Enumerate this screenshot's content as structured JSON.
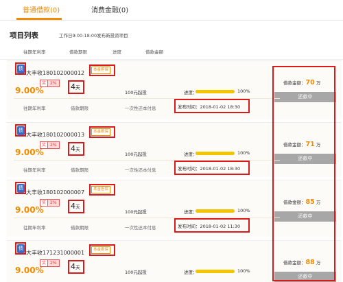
{
  "tabs": [
    {
      "label": "普通借款(0)",
      "active": true
    },
    {
      "label": "消费金融(0)",
      "active": false
    }
  ],
  "section": {
    "title": "项目列表",
    "subtitle": "工作日9:00-18:00发布新投资项目"
  },
  "columns": [
    "往期年利率",
    "借款期限",
    "进度",
    "借款金额"
  ],
  "labels": {
    "rate_label": "往期年利率",
    "term_label": "借款期限",
    "repay_label": "一次性还本付息",
    "progress_label": "进度：",
    "amount_prefix": "借款金额：",
    "amount_unit": "万",
    "reward_prefix": "奖",
    "icon_char": "债"
  },
  "projects": [
    {
      "name": "大丰收180102000012",
      "badge": "本金担保",
      "rate": "9.00%",
      "reward": "2%",
      "term_num": "4",
      "term_unit": "天",
      "min_invest": "100元起投",
      "progress_pct": "100%",
      "progress": 1.0,
      "publish_time": "发布时间：2018-01-02 18:30",
      "amount": "70",
      "status": "还款中"
    },
    {
      "name": "大丰收180102000013",
      "badge": "本金担保",
      "rate": "9.00%",
      "reward": "2%",
      "term_num": "4",
      "term_unit": "天",
      "min_invest": "100元起投",
      "progress_pct": "100%",
      "progress": 1.0,
      "publish_time": "发布时间：2018-01-02 18:30",
      "amount": "71",
      "status": "还款中"
    },
    {
      "name": "大丰收180102000007",
      "badge": "本金担保",
      "rate": "9.00%",
      "reward": "2%",
      "term_num": "4",
      "term_unit": "天",
      "min_invest": "100元起投",
      "progress_pct": "100%",
      "progress": 1.0,
      "publish_time": "发布时间：2018-01-02 11:30",
      "amount": "85",
      "status": "还款中"
    },
    {
      "name": "大丰收171231000001",
      "badge": "本金担保",
      "rate": "9.00%",
      "reward": "2%",
      "term_num": "4",
      "term_unit": "天",
      "min_invest": "100元起投",
      "progress_pct": "100%",
      "progress": 1.0,
      "publish_time": "",
      "amount": "88",
      "status": "还款中"
    }
  ],
  "colors": {
    "accent": "#f08a00",
    "highlight": "#d91a1a",
    "progress": "#f3c400",
    "status_bg": "#a7a7a7"
  }
}
